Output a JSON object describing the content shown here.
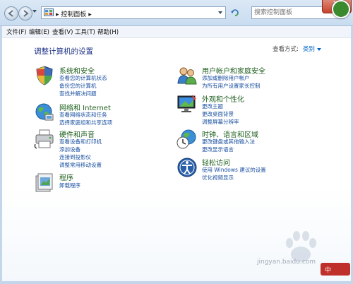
{
  "address": {
    "breadcrumb": "控制面板",
    "search_placeholder": "搜索控制面板"
  },
  "menu": [
    "文件(F)",
    "编辑(E)",
    "查看(V)",
    "工具(T)",
    "帮助(H)"
  ],
  "content": {
    "heading": "调整计算机的设置",
    "view_by_label": "查看方式:",
    "view_by_value": "类别"
  },
  "categories_left": [
    {
      "title": "系统和安全",
      "icon": "shield-icon",
      "links": [
        "查看您的计算机状态",
        "备份您的计算机",
        "查找并解决问题"
      ]
    },
    {
      "title": "网络和 Internet",
      "icon": "globe-network-icon",
      "links": [
        "查看网络状态和任务",
        "选择家庭组和共享选项"
      ]
    },
    {
      "title": "硬件和声音",
      "icon": "printer-icon",
      "links": [
        "查看设备和打印机",
        "添加设备",
        "连接到投影仪",
        "调整常用移动设置"
      ]
    },
    {
      "title": "程序",
      "icon": "programs-icon",
      "links": [
        "卸载程序"
      ]
    }
  ],
  "categories_right": [
    {
      "title": "用户帐户和家庭安全",
      "icon": "users-icon",
      "links": [
        "添加或删除用户帐户",
        "为所有用户设置家长控制"
      ]
    },
    {
      "title": "外观和个性化",
      "icon": "monitor-icon",
      "links": [
        "更改主题",
        "更改桌面背景",
        "调整屏幕分辨率"
      ]
    },
    {
      "title": "时钟、语言和区域",
      "icon": "clock-globe-icon",
      "links": [
        "更改键盘或其他输入法",
        "更改显示语言"
      ]
    },
    {
      "title": "轻松访问",
      "icon": "accessibility-icon",
      "links": [
        "使用 Windows 建议的设置",
        "优化视频显示"
      ]
    }
  ],
  "watermark": {
    "text": "jingyan.baidu.com",
    "badge": "中"
  }
}
